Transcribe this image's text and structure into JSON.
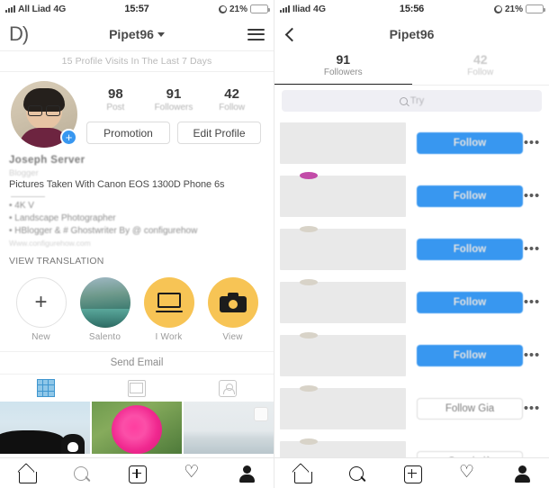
{
  "left": {
    "status": {
      "carrier": "All Liad",
      "network": "4G",
      "time": "15:57",
      "battery_pct": "21%"
    },
    "header": {
      "logo": "D)",
      "title": "Pipet96",
      "menu_icon": "hamburger-icon"
    },
    "visits_banner": "15 Profile Visits In The Last 7 Days",
    "stats": [
      {
        "num": "98",
        "label": "Post"
      },
      {
        "num": "91",
        "label": "Followers"
      },
      {
        "num": "42",
        "label": "Follow"
      }
    ],
    "buttons": {
      "promotion": "Promotion",
      "edit_profile": "Edit Profile"
    },
    "bio": {
      "name": "Joseph Server",
      "category": "Blogger",
      "headline": "Pictures Taken With Canon EOS 1300D Phone 6s",
      "items": [
        "• 4K V",
        "• Landscape Photographer",
        "• HBlogger & # Ghostwriter By @ configurehow"
      ],
      "url": "Www.configurehow.com",
      "view_translation": "VIEW TRANSLATION"
    },
    "highlights": [
      {
        "label": "New",
        "icon": "plus-icon"
      },
      {
        "label": "Salento",
        "icon": "photo-thumb"
      },
      {
        "label": "I Work",
        "icon": "laptop-icon"
      },
      {
        "label": "View",
        "icon": "camera-icon"
      }
    ],
    "send_email": "Send Email",
    "content_tabs": [
      "grid-icon",
      "list-icon",
      "tagged-icon"
    ]
  },
  "right": {
    "status": {
      "carrier": "Iliad",
      "network": "4G",
      "time": "15:56",
      "battery_pct": "21%"
    },
    "header": {
      "back_icon": "back-chevron-icon",
      "title": "Pipet96"
    },
    "tabs": [
      {
        "count": "91",
        "label": "Followers",
        "active": true
      },
      {
        "count": "42",
        "label": "Follow",
        "active": false
      }
    ],
    "search": {
      "placeholder": "Try",
      "icon": "search-icon"
    },
    "rows": [
      {
        "action": "Follow",
        "style": "blue",
        "more": "•••"
      },
      {
        "action": "Follow",
        "style": "blue",
        "more": "•••"
      },
      {
        "action": "Follow",
        "style": "blue",
        "more": "•••"
      },
      {
        "action": "Follow",
        "style": "blue",
        "more": "•••"
      },
      {
        "action": "Follow",
        "style": "blue",
        "more": "•••"
      },
      {
        "action": "Follow Gia",
        "style": "outline",
        "more": "•••"
      },
      {
        "action": "Segui già",
        "style": "outline",
        "more": "•••"
      }
    ]
  },
  "bottom_nav": [
    "home-icon",
    "search-icon",
    "add-icon",
    "heart-icon",
    "profile-icon"
  ],
  "colors": {
    "accent_blue": "#3897f0",
    "highlight_yellow": "#f7c455",
    "battery_yellow": "#f5c518"
  }
}
